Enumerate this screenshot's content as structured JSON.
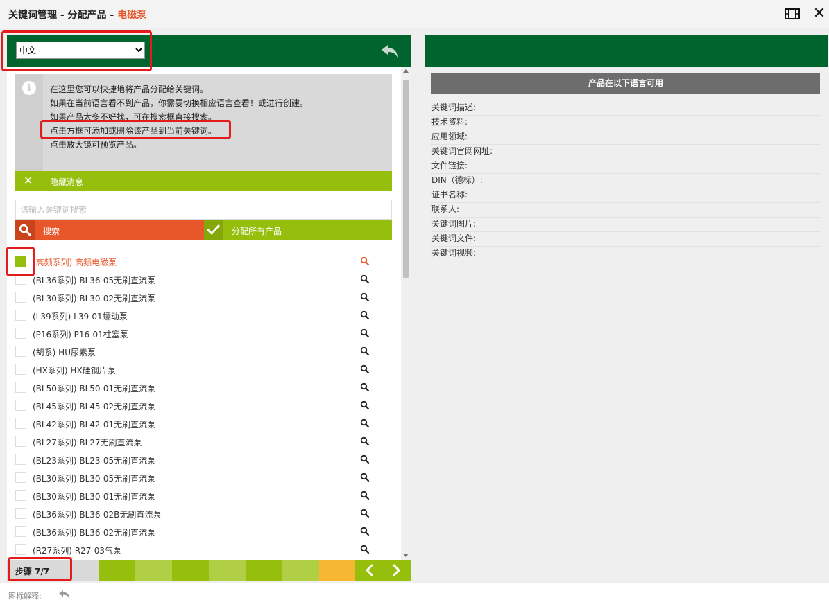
{
  "window": {
    "title_prefix": "关键词管理 - 分配产品 - ",
    "title_highlight": "电磁泵"
  },
  "language_select": {
    "selected": "中文",
    "options": [
      "中文"
    ]
  },
  "info": {
    "lines": [
      "在这里您可以快捷地将产品分配给关键词。",
      "如果在当前语言看不到产品，你需要切换相应语言查看！或进行创建。",
      "如果产品太多不好找，可在搜索框直接搜索。",
      "点击方框可添加或删除该产品到当前关键词。",
      "点击放大镜可预览产品。"
    ],
    "hide_label": "隐藏消息"
  },
  "search": {
    "placeholder": "请输入关键词搜索",
    "search_label": "搜索",
    "assign_all_label": "分配所有产品"
  },
  "products": [
    {
      "name": "(高频系列) 高频电磁泵",
      "checked": true
    },
    {
      "name": "(BL36系列) BL36-05无刷直流泵",
      "checked": false
    },
    {
      "name": "(BL30系列) BL30-02无刷直流泵",
      "checked": false
    },
    {
      "name": "(L39系列) L39-01蠕动泵",
      "checked": false
    },
    {
      "name": "(P16系列) P16-01柱塞泵",
      "checked": false
    },
    {
      "name": "(胡系) HU尿素泵",
      "checked": false
    },
    {
      "name": "(HX系列) HX硅钢片泵",
      "checked": false
    },
    {
      "name": "(BL50系列) BL50-01无刷直流泵",
      "checked": false
    },
    {
      "name": "(BL45系列) BL45-02无刷直流泵",
      "checked": false
    },
    {
      "name": "(BL42系列) BL42-01无刷直流泵",
      "checked": false
    },
    {
      "name": "(BL27系列) BL27无刷直流泵",
      "checked": false
    },
    {
      "name": "(BL23系列) BL23-05无刷直流泵",
      "checked": false
    },
    {
      "name": "(BL30系列) BL30-05无刷直流泵",
      "checked": false
    },
    {
      "name": "(BL30系列) BL30-01无刷直流泵",
      "checked": false
    },
    {
      "name": "(BL36系列) BL36-02B无刷直流泵",
      "checked": false
    },
    {
      "name": "(BL36系列) BL36-02无刷直流泵",
      "checked": false
    },
    {
      "name": "(R27系列) R27-03气泵",
      "checked": false
    }
  ],
  "steps": {
    "label": "步骤 7/7",
    "segment_colors": [
      "#96bf0d",
      "#b0cf45",
      "#96bf0d",
      "#b0cf45",
      "#96bf0d",
      "#b0cf45",
      "#f7b733"
    ]
  },
  "right": {
    "available_title": "产品在以下语言可用",
    "fields": [
      "关键词描述:",
      "技术资料:",
      "应用领域:",
      "关键词官网网址:",
      "文件链接:",
      "DIN（德标）:",
      "证书名称:",
      "联系人:",
      "关键词图片:",
      "关键词文件:",
      "关键词视频:"
    ]
  },
  "footer": {
    "legend_label": "图标解释:"
  },
  "colors": {
    "brand_green": "#00642f",
    "lime": "#96bf0d",
    "orange": "#e8572a",
    "annotation_red": "#e31b1b"
  }
}
